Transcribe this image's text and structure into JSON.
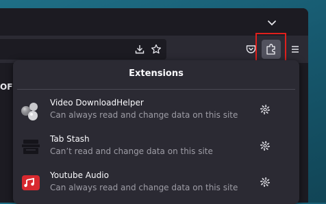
{
  "colors": {
    "accent_red": "#e0201c",
    "panel_bg": "#2b2a33",
    "window_bg": "#1c1b22"
  },
  "icons": {
    "tab_list": "chevron-down-icon",
    "save_page": "download-icon",
    "bookmark": "star-icon",
    "pocket": "pocket-icon",
    "extensions": "puzzle-icon",
    "menu": "hamburger-menu-icon",
    "search": "search-icon"
  },
  "page": {
    "left_text": "OF"
  },
  "extensions_panel": {
    "title": "Extensions",
    "items": [
      {
        "name": "Video DownloadHelper",
        "status": "Can always read and change data on this site",
        "icon": "video-downloadhelper-icon"
      },
      {
        "name": "Tab Stash",
        "status": "Can’t read and change data on this site",
        "icon": "tab-stash-icon"
      },
      {
        "name": "Youtube Audio",
        "status": "Can always read and change data on this site",
        "icon": "youtube-audio-icon"
      }
    ]
  }
}
